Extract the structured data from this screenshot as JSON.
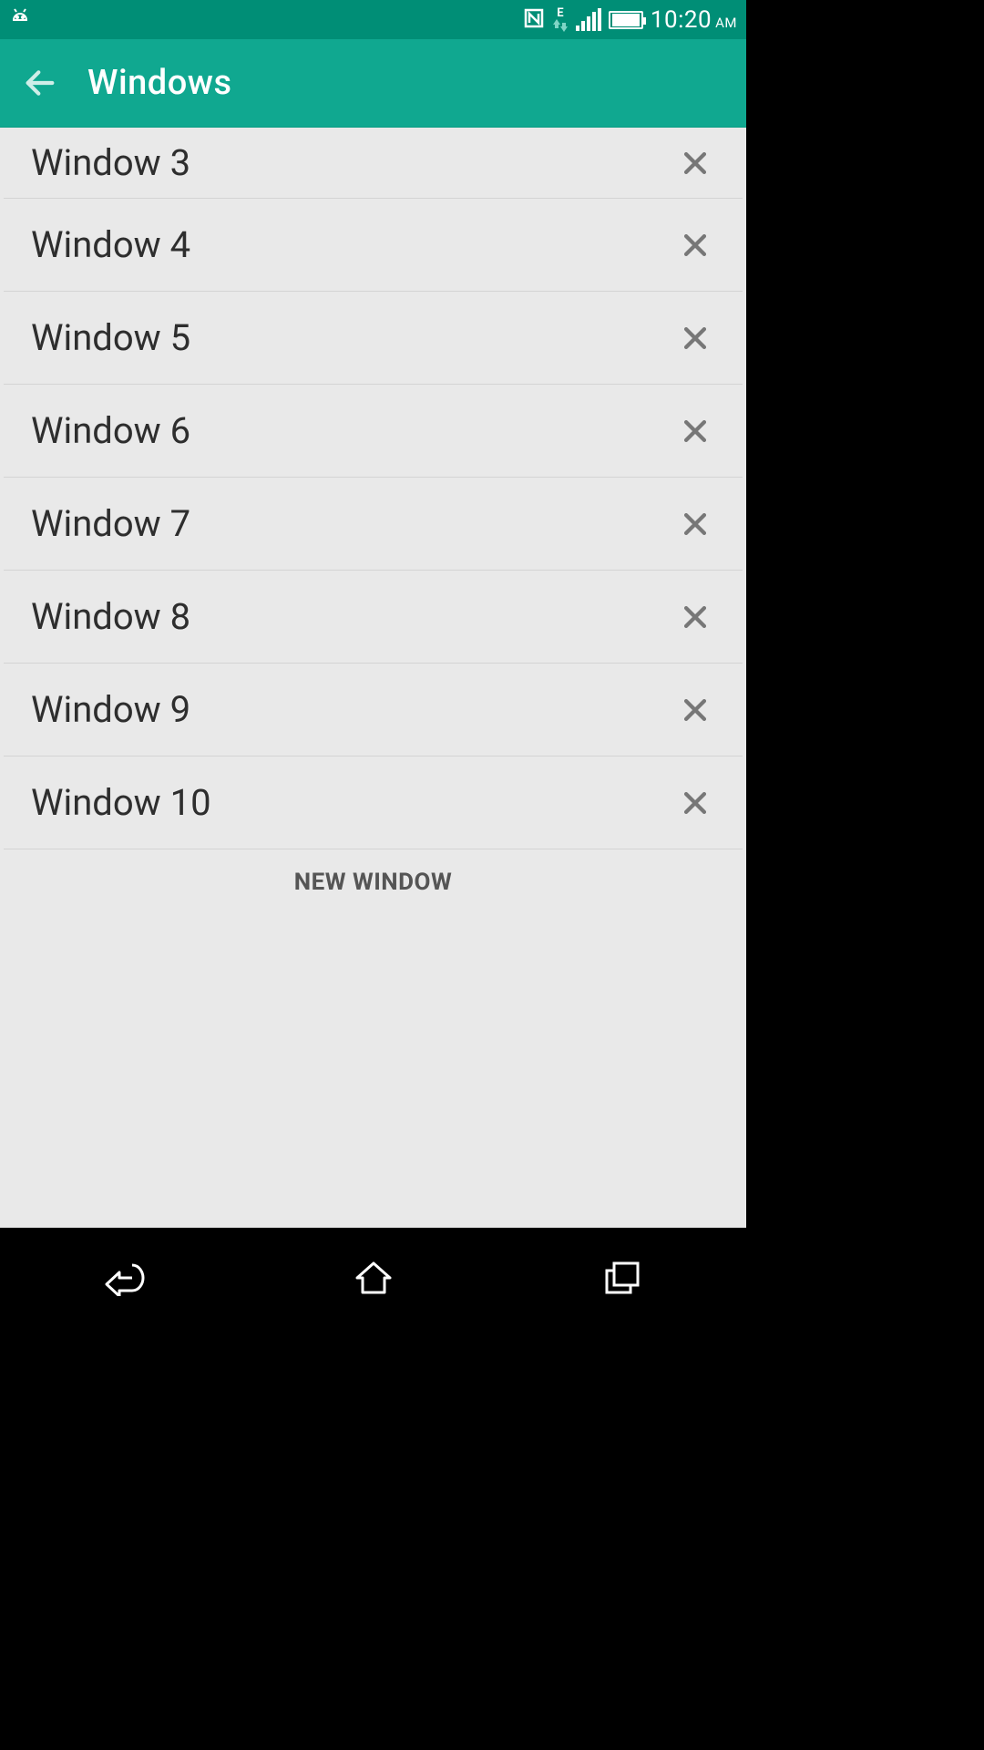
{
  "colors": {
    "accent": "#10a890",
    "status_bg": "#008e76"
  },
  "status_bar": {
    "time": "10:20",
    "ampm": "AM",
    "network_type": "E"
  },
  "app_bar": {
    "title": "Windows"
  },
  "windows": [
    {
      "label": "Window 3"
    },
    {
      "label": "Window 4"
    },
    {
      "label": "Window 5"
    },
    {
      "label": "Window 6"
    },
    {
      "label": "Window 7"
    },
    {
      "label": "Window 8"
    },
    {
      "label": "Window 9"
    },
    {
      "label": "Window 10"
    }
  ],
  "footer": {
    "new_window_label": "NEW WINDOW"
  }
}
